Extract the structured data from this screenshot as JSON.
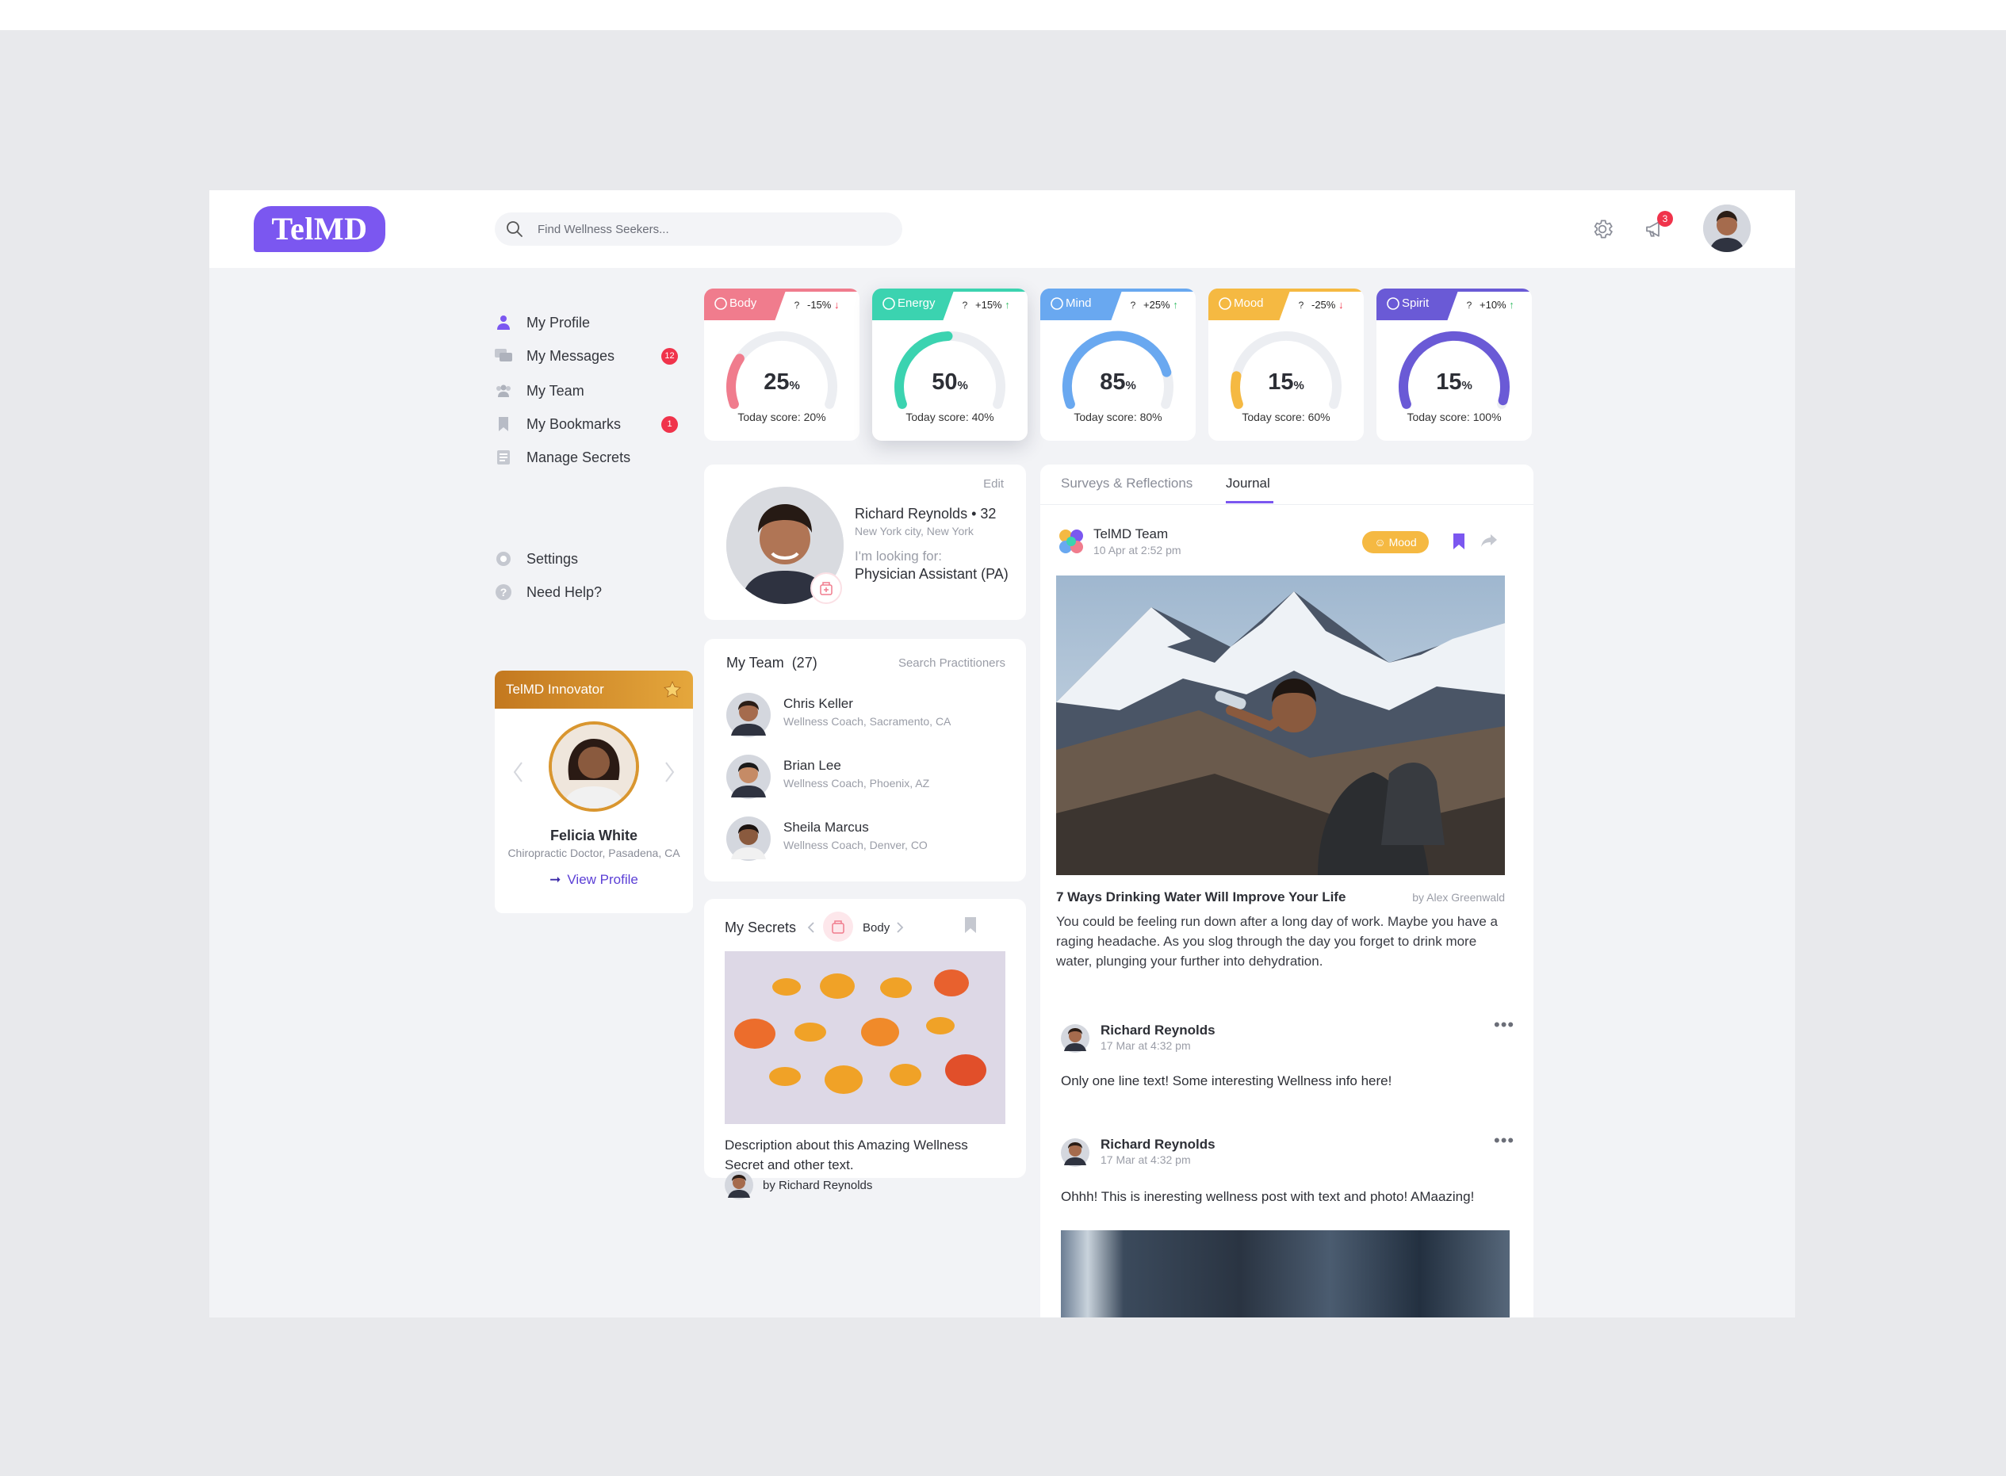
{
  "app": {
    "logo": "TelMD"
  },
  "header": {
    "search_placeholder": "Find Wellness Seekers...",
    "notification_count": "3"
  },
  "sidebar": {
    "items": [
      {
        "label": "My Profile",
        "icon": "user-icon"
      },
      {
        "label": "My Messages",
        "icon": "chat-icon",
        "count": "12"
      },
      {
        "label": "My Team",
        "icon": "team-icon"
      },
      {
        "label": "My Bookmarks",
        "icon": "bookmark-icon",
        "count": "1"
      },
      {
        "label": "Manage Secrets",
        "icon": "document-icon"
      }
    ],
    "footer_items": [
      {
        "label": "Settings",
        "icon": "gear-icon"
      },
      {
        "label": "Need Help?",
        "icon": "help-icon"
      }
    ]
  },
  "innovator": {
    "title": "TelMD Innovator",
    "name": "Felicia White",
    "role": "Chiropractic Doctor, Pasadena, CA",
    "link": "View Profile"
  },
  "stats": [
    {
      "label": "Body",
      "change": "-15%",
      "direction": "down",
      "value": "25",
      "unit": "%",
      "today": "Today score: 20%",
      "color": "#f07c8d",
      "level": 0.25
    },
    {
      "label": "Energy",
      "change": "+15%",
      "direction": "up",
      "value": "50",
      "unit": "%",
      "today": "Today score: 40%",
      "color": "#3bd3b0",
      "level": 0.5
    },
    {
      "label": "Mind",
      "change": "+25%",
      "direction": "up",
      "value": "85",
      "unit": "%",
      "today": "Today score: 80%",
      "color": "#69a8f0",
      "level": 0.85
    },
    {
      "label": "Mood",
      "change": "-25%",
      "direction": "down",
      "value": "15",
      "unit": "%",
      "today": "Today score: 60%",
      "color": "#f5b942",
      "level": 0.15
    },
    {
      "label": "Spirit",
      "change": "+10%",
      "direction": "up",
      "value": "15",
      "unit": "%",
      "today": "Today score: 100%",
      "color": "#6a5ad6",
      "level": 1.0
    }
  ],
  "profile": {
    "edit": "Edit",
    "name": "Richard Reynolds • 32",
    "location": "New York city, New York",
    "looking_label": "I'm looking for:",
    "looking_value": "Physician Assistant (PA)"
  },
  "team": {
    "title": "My Team  (27)",
    "search": "Search Practitioners",
    "members": [
      {
        "name": "Chris Keller",
        "role": "Wellness Coach, Sacramento, CA"
      },
      {
        "name": "Brian Lee",
        "role": "Wellness Coach, Phoenix, AZ"
      },
      {
        "name": "Sheila Marcus",
        "role": "Wellness Coach, Denver, CO"
      }
    ]
  },
  "secrets": {
    "title": "My Secrets",
    "category": "Body",
    "description": "Description about this Amazing Wellness Secret and other text.",
    "author": "by Richard Reynolds"
  },
  "feed": {
    "tabs": [
      "Surveys & Reflections",
      "Journal"
    ],
    "active_tab": "Journal",
    "post1": {
      "author": "TelMD Team",
      "time": "10 Apr at 2:52 pm",
      "tag": "Mood",
      "title": "7 Ways Drinking Water Will Improve Your Life",
      "byline": "by Alex Greenwald",
      "body": "You could be feeling run down after a long day of work. Maybe you have a raging headache. As you slog through the day you forget to drink more water, plunging your further into dehydration."
    },
    "post2": {
      "author": "Richard Reynolds",
      "time": "17 Mar at 4:32 pm",
      "body": "Only one line text! Some interesting Wellness info here!"
    },
    "post3": {
      "author": "Richard Reynolds",
      "time": "17 Mar at 4:32 pm",
      "body": "Ohhh! This is ineresting wellness post with text and photo! AMaazing!"
    }
  },
  "colors": {
    "accent": "#7b57f0",
    "alert": "#f0334b",
    "gold": "#d9962f"
  }
}
